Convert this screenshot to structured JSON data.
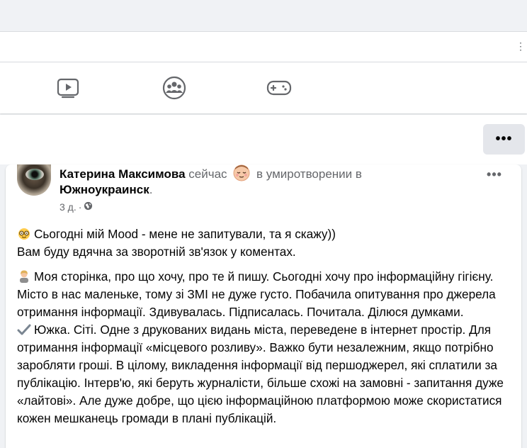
{
  "browser": {
    "menu_icon": "vertical-dots-icon"
  },
  "nav": {
    "icons": [
      "watch-video-icon",
      "groups-icon",
      "gaming-icon"
    ]
  },
  "profile": {
    "more_label": "•••"
  },
  "post": {
    "author": "Катерина Максимова",
    "status_prefix": "сейчас",
    "feeling": "в умиротворении в",
    "location": "Южноукраинск",
    "location_suffix": ".",
    "time": "3 д.",
    "separator": "·",
    "audience_icon": "globe-icon",
    "more_label": "•••",
    "paragraphs": {
      "p1_line1": "Сьогодні мій Mood - мене не запитували, та я скажу))",
      "p1_line2": "Вам буду вдячна за зворотній зв'язок у коментах.",
      "p2": "Моя сторінка, про що хочу, про те й пишу. Сьогодні хочу про інформаційну гігієну. Місто в нас маленьке, тому зі ЗМІ не дуже густо. Побачила опитування про джерела отримання інформації. Здивувалась. Підписалась. Почитала. Ділюся думками.",
      "p3": "Южка. Сіті. Одне з друкованих видань міста, переведене в інтернет простір. Для отримання інформації «місцевого розливу». Важко бути незалежним, якщо потрібно заробляти гроші. В цілому, викладення інформації від першоджерел, які сплатили за публікацію. Інтерв'ю, які беруть журналісти, більше схожі на замовні - запитання дуже «лайтові». Але дуже добре, що цією інформаційною платформою може скористатися кожен мешканець громади в плані публікацій."
    }
  },
  "colors": {
    "bg": "#f0f2f5",
    "text": "#050505",
    "secondary": "#65676b",
    "card": "#ffffff"
  }
}
